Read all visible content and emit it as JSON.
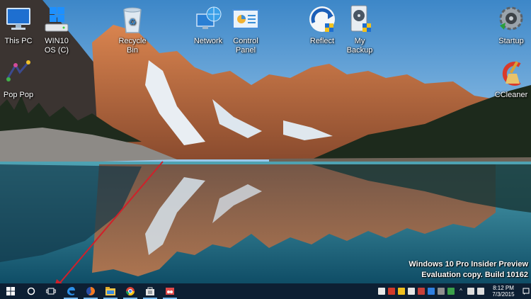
{
  "desktop": {
    "icons": [
      {
        "label": "This PC"
      },
      {
        "label": "WIN10\nOS (C)"
      },
      {
        "label": "Recycle\nBin"
      },
      {
        "label": "Network"
      },
      {
        "label": "Control\nPanel"
      },
      {
        "label": "Reflect"
      },
      {
        "label": "My\nBackup"
      },
      {
        "label": "Startup"
      },
      {
        "label": "Pop Pop"
      },
      {
        "label": "CCleaner"
      }
    ]
  },
  "watermark": {
    "line1": "Windows 10 Pro Insider Preview",
    "line2": "Evaluation copy. Build 10162"
  },
  "taskbar": {
    "start": "start-icon",
    "search": "cortana-icon",
    "task_view": "task-view-icon",
    "pinned": [
      "edge-icon",
      "firefox-icon",
      "file-explorer-icon",
      "chrome-icon",
      "store-icon",
      "snipping-tool-icon"
    ],
    "clock": {
      "time": "8:12 PM",
      "date": "7/3/2015"
    }
  },
  "colors": {
    "taskbar_bg": "#0d1f33",
    "accent": "#76b9ed",
    "arrow": "#d0202a"
  }
}
